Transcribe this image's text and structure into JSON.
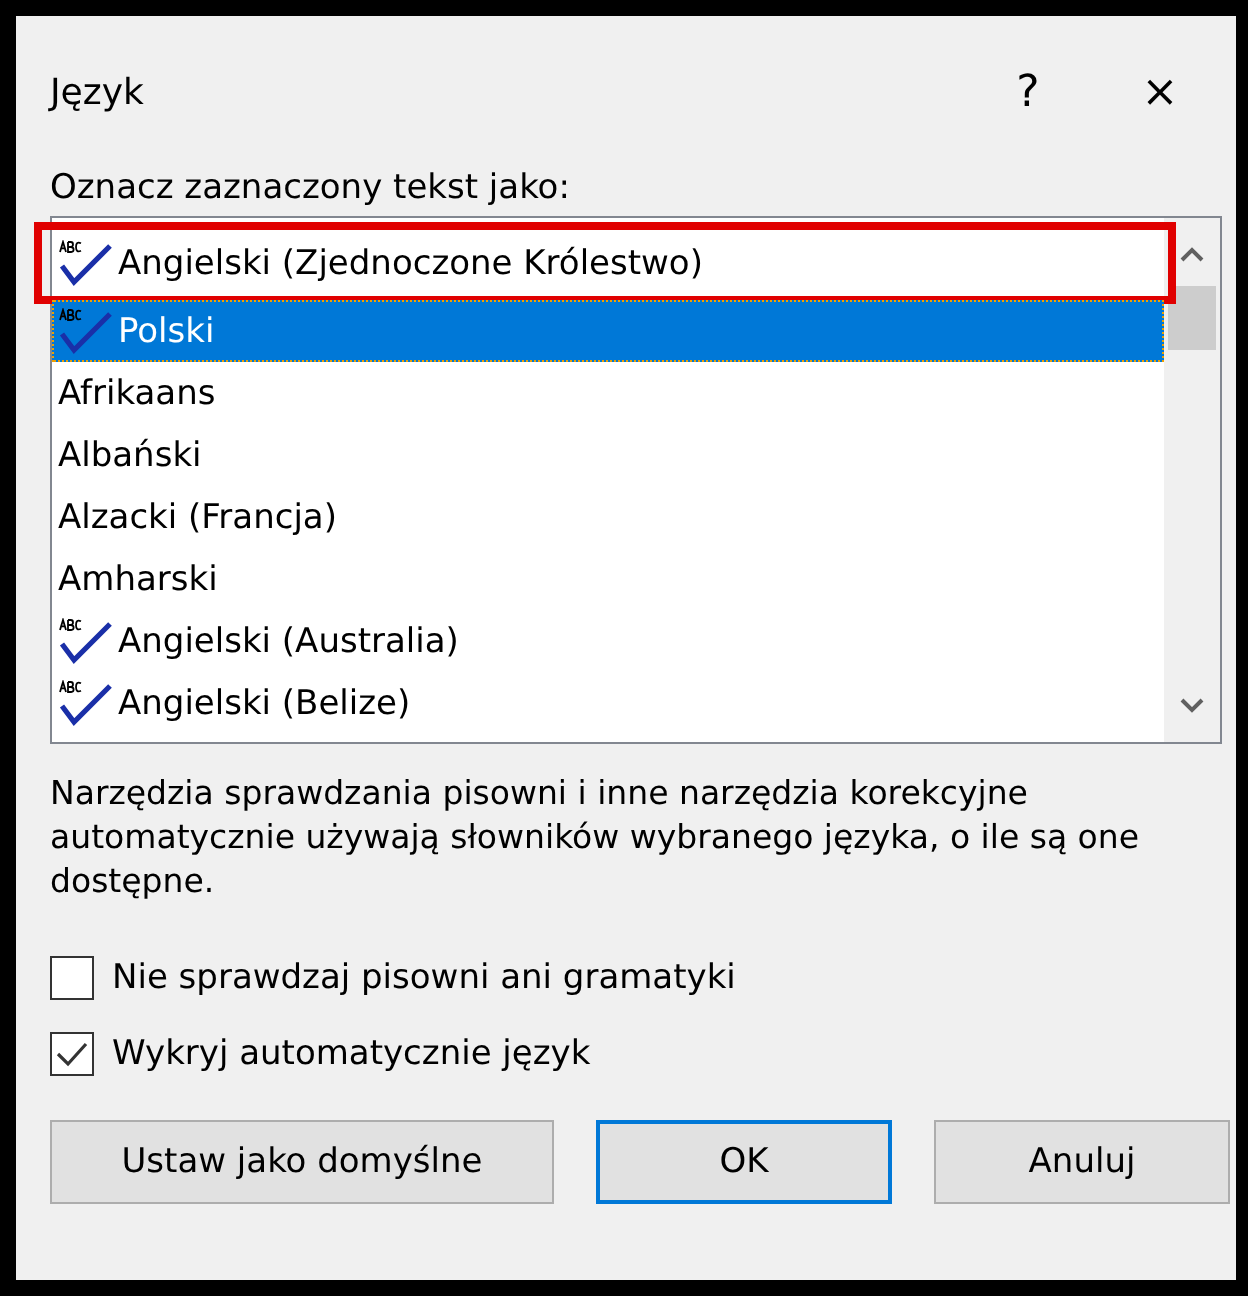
{
  "window": {
    "title": "Język",
    "help": "?",
    "close": "×"
  },
  "list_label": "Oznacz zaznaczony tekst jako:",
  "languages": [
    {
      "label": "Angielski (Zjednoczone Królestwo)",
      "kind": "spell",
      "selected": false,
      "marked": true
    },
    {
      "label": "Polski",
      "kind": "spell",
      "selected": true,
      "marked": false
    },
    {
      "label": "Afrikaans",
      "kind": "plain",
      "selected": false,
      "marked": false
    },
    {
      "label": "Albański",
      "kind": "plain",
      "selected": false,
      "marked": false
    },
    {
      "label": "Alzacki (Francja)",
      "kind": "plain",
      "selected": false,
      "marked": false
    },
    {
      "label": "Amharski",
      "kind": "plain",
      "selected": false,
      "marked": false
    },
    {
      "label": "Angielski (Australia)",
      "kind": "spell",
      "selected": false,
      "marked": false
    },
    {
      "label": "Angielski (Belize)",
      "kind": "spell",
      "selected": false,
      "marked": false
    }
  ],
  "description": "Narzędzia sprawdzania pisowni i inne narzędzia korekcyjne automatycznie używają słowników wybranego języka, o ile są one dostępne.",
  "options": [
    {
      "label": "Nie sprawdzaj pisowni ani gramatyki",
      "checked": false
    },
    {
      "label": "Wykryj automatycznie język",
      "checked": true
    }
  ],
  "buttons": [
    {
      "label": "Ustaw jako domyślne",
      "focused": false
    },
    {
      "label": "OK",
      "focused": true
    },
    {
      "label": "Anuluj",
      "focused": false
    }
  ]
}
